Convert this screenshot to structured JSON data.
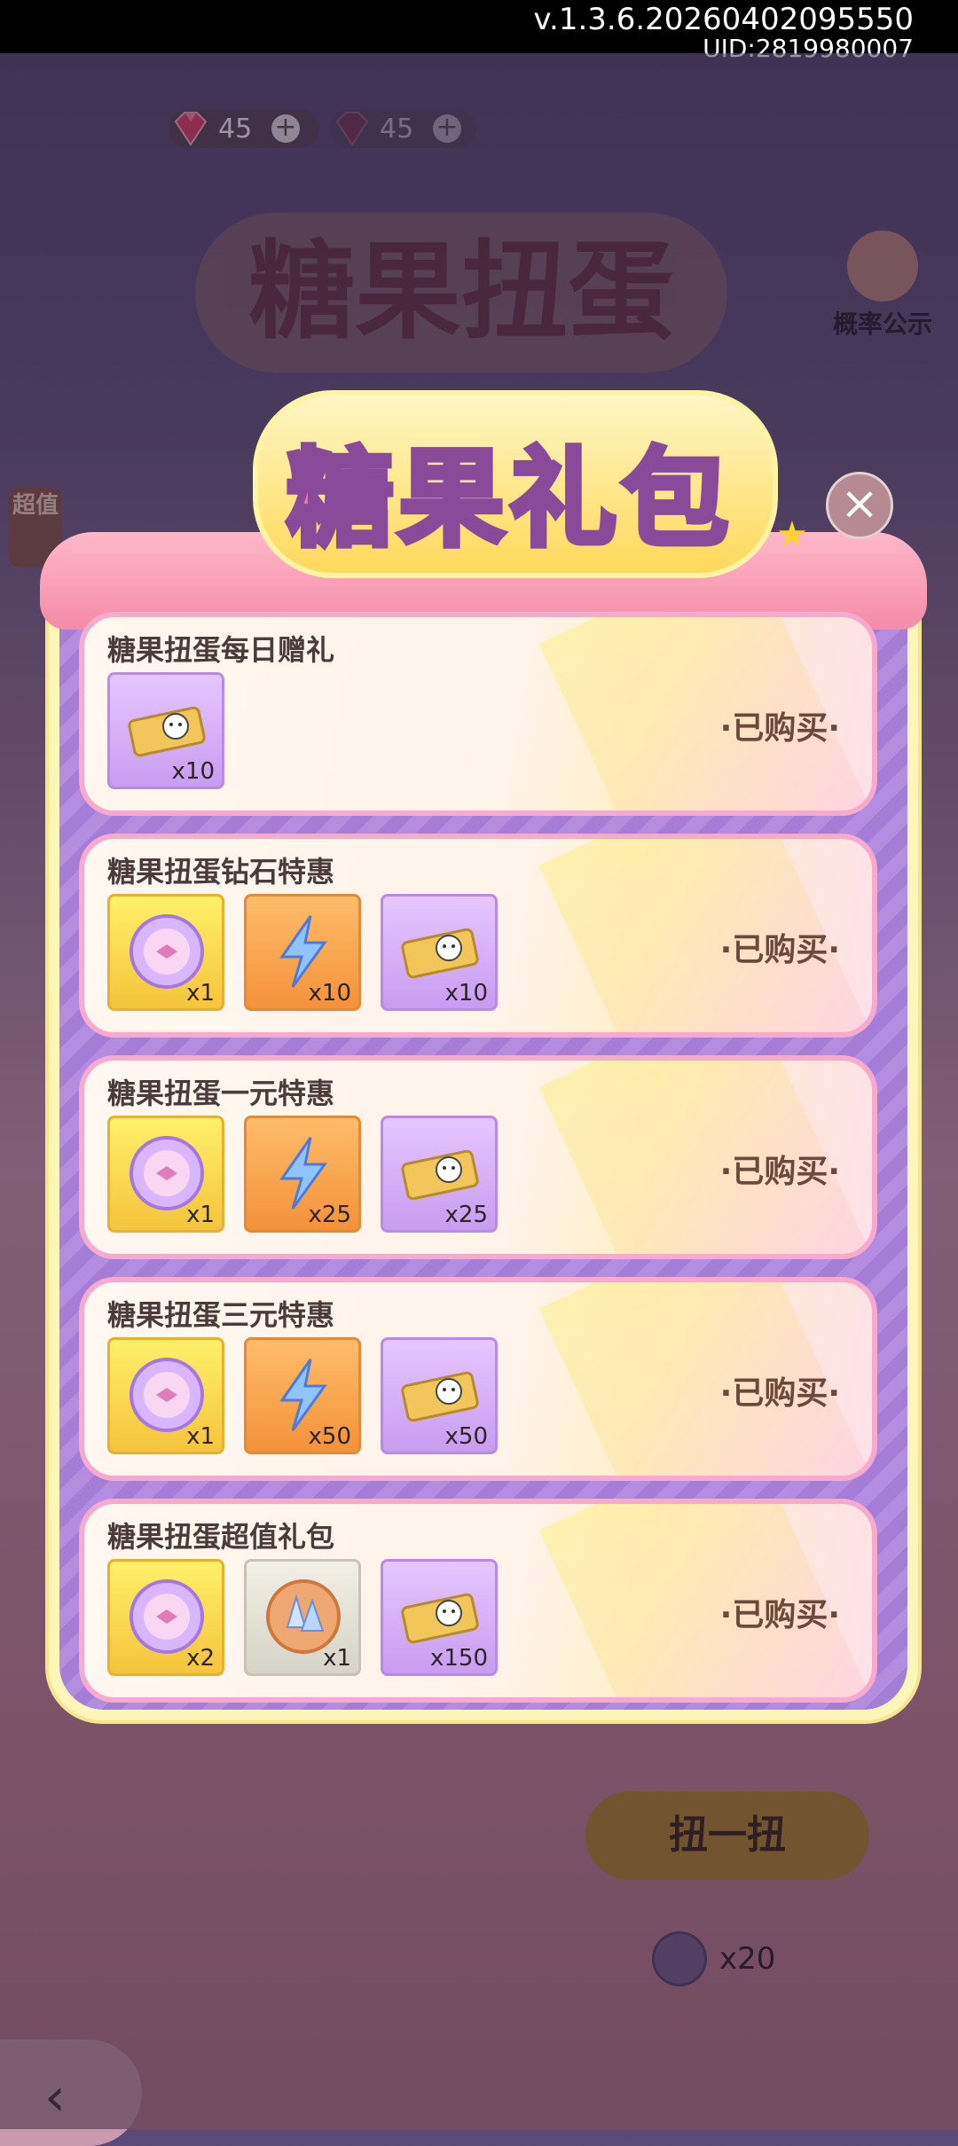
{
  "system": {
    "version": "v.1.3.6.20260402095550",
    "uid": "UID:2819980007"
  },
  "currency": [
    {
      "name": "gem-red",
      "value": "45",
      "color": "#e2436f"
    },
    {
      "name": "gem-dark",
      "value": "45",
      "color": "#8a3048"
    }
  ],
  "background": {
    "title": "糖果扭蛋",
    "probability_label": "概率公示",
    "side_tag": "超值",
    "gacha_button": "扭一扭",
    "gacha_cost": "x20"
  },
  "dialog": {
    "title": "糖果礼包",
    "close_icon": "close-icon",
    "packs": [
      {
        "title": "糖果扭蛋每日赠礼",
        "status": "·已购买·",
        "items": [
          {
            "icon": "ticket-icon",
            "style": "purple",
            "qty": "x10"
          }
        ]
      },
      {
        "title": "糖果扭蛋钻石特惠",
        "status": "·已购买·",
        "items": [
          {
            "icon": "candy-coin-icon",
            "style": "yellow",
            "qty": "x1"
          },
          {
            "icon": "lightning-icon",
            "style": "orange",
            "qty": "x10"
          },
          {
            "icon": "ticket-icon",
            "style": "purple",
            "qty": "x10"
          }
        ]
      },
      {
        "title": "糖果扭蛋一元特惠",
        "status": "·已购买·",
        "items": [
          {
            "icon": "candy-coin-icon",
            "style": "yellow",
            "qty": "x1"
          },
          {
            "icon": "lightning-icon",
            "style": "orange",
            "qty": "x25"
          },
          {
            "icon": "ticket-icon",
            "style": "purple",
            "qty": "x25"
          }
        ]
      },
      {
        "title": "糖果扭蛋三元特惠",
        "status": "·已购买·",
        "items": [
          {
            "icon": "candy-coin-icon",
            "style": "yellow",
            "qty": "x1"
          },
          {
            "icon": "lightning-icon",
            "style": "orange",
            "qty": "x50"
          },
          {
            "icon": "ticket-icon",
            "style": "purple",
            "qty": "x50"
          }
        ]
      },
      {
        "title": "糖果扭蛋超值礼包",
        "status": "·已购买·",
        "items": [
          {
            "icon": "candy-coin-icon",
            "style": "yellow",
            "qty": "x2"
          },
          {
            "icon": "crystal-icon",
            "style": "grey",
            "qty": "x1"
          },
          {
            "icon": "ticket-icon",
            "style": "purple",
            "qty": "x150"
          }
        ]
      }
    ]
  }
}
